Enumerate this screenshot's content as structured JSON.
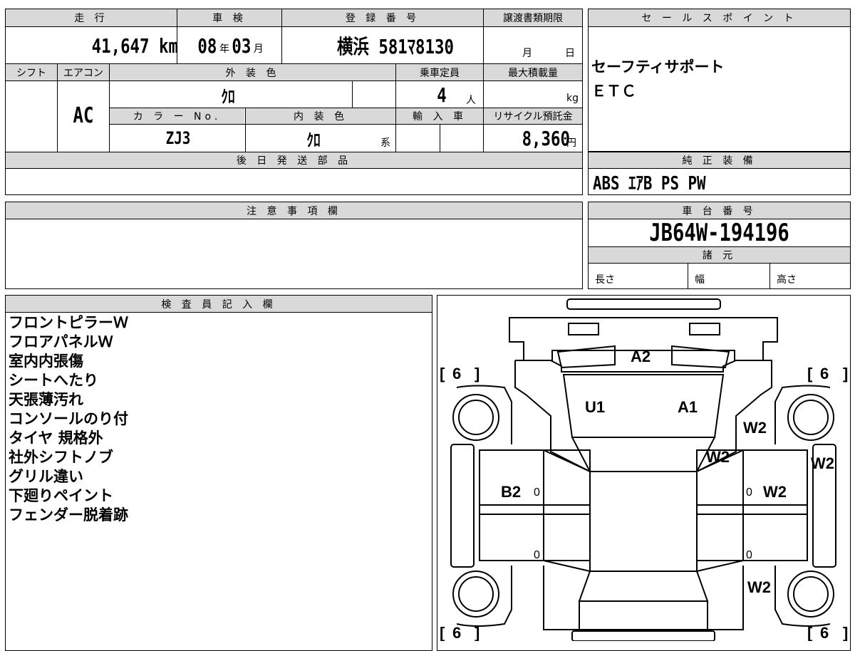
{
  "vehicle": {
    "mileage_header": "走 行",
    "mileage": "41,647",
    "mileage_unit": "km",
    "inspection_header": "車 検",
    "inspection_year": "08",
    "year_unit": "年",
    "inspection_month": "03",
    "month_unit": "月",
    "registration_header": "登 録 番 号",
    "registration": "横浜 581ﾏ8130",
    "transfer_doc_header": "譲渡書類期限",
    "transfer_month_unit": "月",
    "transfer_day_unit": "日",
    "shift_header": "シフト",
    "aircon_header": "エアコン",
    "aircon": "AC",
    "exterior_color_header": "外 装 色",
    "exterior_color": "ｸﾛ",
    "capacity_header": "乗車定員",
    "capacity": "4",
    "capacity_unit": "人",
    "max_load_header": "最大積載量",
    "max_load_unit": "kg",
    "color_no_header": "カ ラ ー No.",
    "color_no": "ZJ3",
    "interior_color_header": "内 装 色",
    "interior_color": "ｸﾛ",
    "interior_suffix": "系",
    "import_header": "輸 入 車",
    "recycle_header": "リサイクル預託金",
    "recycle_fee": "8,360",
    "recycle_unit": "円",
    "later_parts_header": "後 日 発 送 部 品"
  },
  "sales_points": {
    "header": "セ ー ル ス ポ イ ン ト",
    "items": [
      "セーフティサポート",
      "ＥＴＣ"
    ]
  },
  "equipment": {
    "header": "純 正 装 備",
    "value": "ABS ｴｱB PS PW"
  },
  "caution": {
    "header": "注 意 事 項 欄"
  },
  "chassis": {
    "header": "車 台 番 号",
    "value": "JB64W-194196",
    "spec_header": "諸 元",
    "length_label": "長さ",
    "width_label": "幅",
    "height_label": "高さ"
  },
  "inspector": {
    "header": "検 査 員 記 入 欄",
    "notes": [
      "フロントピラーＷ",
      "フロアパネルＷ",
      "室内内張傷",
      "シートへたり",
      "天張薄汚れ",
      "コンソールのり付",
      "タイヤ 規格外",
      "社外シフトノブ",
      "グリル違い",
      "下廻りペイント",
      "フェンダー脱着跡"
    ]
  },
  "diagram": {
    "tires": [
      "6",
      "6",
      "6",
      "6"
    ],
    "marks": {
      "a2": "A2",
      "u1": "U1",
      "a1": "A1",
      "w2_right_upper": "W2",
      "w2_pillar": "W2",
      "w2_right_side": "W2",
      "b2": "B2",
      "w2_door": "W2",
      "w2_rear": "W2"
    },
    "zeros": [
      "0",
      "0",
      "0",
      "0"
    ]
  }
}
